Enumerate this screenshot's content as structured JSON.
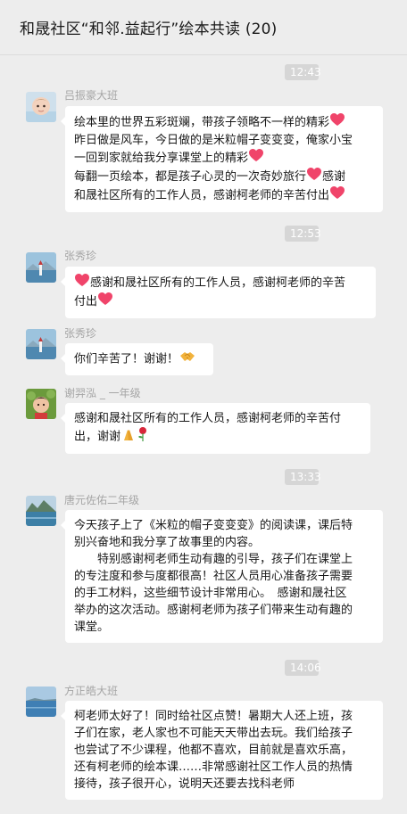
{
  "header": {
    "title": "和晟社区“和邻.益起行”绘本共读 (20)"
  },
  "timestamps": [
    "12:43",
    "12:53",
    "13:33",
    "14:06"
  ],
  "messages": [
    {
      "sender": "吕振豪大班",
      "avatar": "child-avatar",
      "lines": [
        "绘本里的世界五彩斑斓，带孩子领略不一样的精彩",
        "昨日做是风车，今日做的是米粒帽子变变变，俺家小宝",
        "一回到家就给我分享课堂上的精彩",
        "每翻一页绘本，都是孩子心灵的一次奇妙旅行",
        "感谢",
        "和晟社区所有的工作人员，感谢柯老师的辛苦付出"
      ]
    },
    {
      "sender": "张秀珍",
      "avatar": "landscape-avatar",
      "lines": [
        "感谢和晟社区所有的工作人员，感谢柯老师的辛苦",
        "付出"
      ]
    },
    {
      "sender": "张秀珍",
      "avatar": "landscape-avatar",
      "lines": [
        "你们辛苦了！谢谢！"
      ]
    },
    {
      "sender": "谢羿泓 _ 一年级",
      "avatar": "child-avatar",
      "lines": [
        "感谢和晟社区所有的工作人员，感谢柯老师的辛苦付",
        "出，谢谢"
      ]
    },
    {
      "sender": "唐元佐佑二年级",
      "avatar": "mountain-avatar",
      "lines": [
        "今天孩子上了《米粒的帽子变变变》的阅读课，课后特",
        "别兴奋地和我分享了故事里的内容。",
        "　　特别感谢柯老师生动有趣的引导，孩子们在课堂上",
        "的专注度和参与度都很高！社区人员用心准备孩子需要",
        "的手工材料，这些细节设计非常用心。　感谢和晟社区",
        "举办的这次活动。感谢柯老师为孩子们带来生动有趣的",
        "课堂。"
      ]
    },
    {
      "sender": "方正皓大班",
      "avatar": "sea-avatar",
      "lines": [
        "柯老师太好了！同时给社区点赞！暑期大人还上班，孩",
        "子们在家，老人家也不可能天天带出去玩。我们给孩子",
        "也尝试了不少课程，他都不喜欢，目前就是喜欢乐高，",
        "还有柯老师的绘本课……非常感谢社区工作人员的热情",
        "接待，孩子很开心，说明天还要去找科老师"
      ]
    }
  ],
  "colors": {
    "background": "#ededed",
    "bubble": "#ffffff",
    "timestamp_bg": "#d6d6d6",
    "name_text": "#a5a5a5",
    "heart": "#f0446a"
  }
}
